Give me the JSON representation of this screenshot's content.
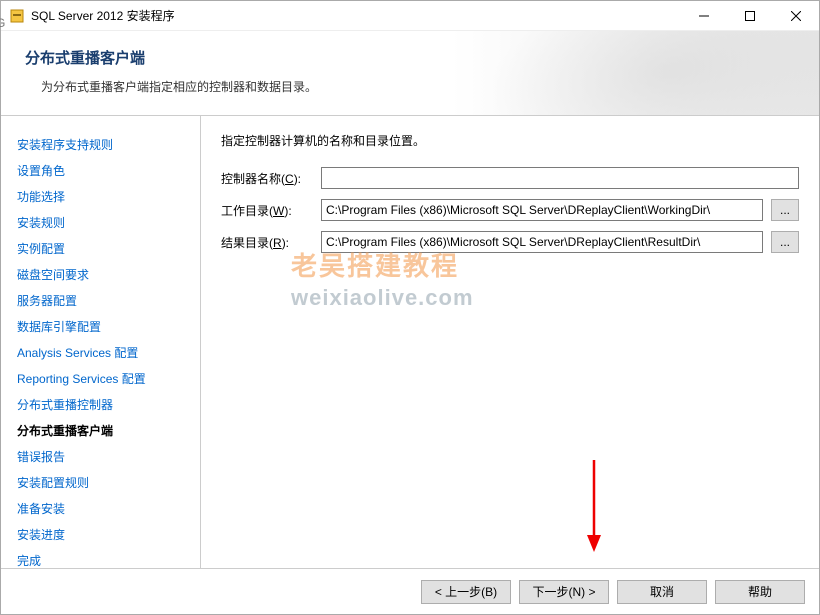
{
  "window": {
    "title": "SQL Server 2012 安装程序"
  },
  "header": {
    "title": "分布式重播客户端",
    "subtitle": "为分布式重播客户端指定相应的控制器和数据目录。"
  },
  "sidebar": {
    "items": [
      {
        "label": "安装程序支持规则",
        "current": false
      },
      {
        "label": "设置角色",
        "current": false
      },
      {
        "label": "功能选择",
        "current": false
      },
      {
        "label": "安装规则",
        "current": false
      },
      {
        "label": "实例配置",
        "current": false
      },
      {
        "label": "磁盘空间要求",
        "current": false
      },
      {
        "label": "服务器配置",
        "current": false
      },
      {
        "label": "数据库引擎配置",
        "current": false
      },
      {
        "label": "Analysis Services 配置",
        "current": false
      },
      {
        "label": "Reporting Services 配置",
        "current": false
      },
      {
        "label": "分布式重播控制器",
        "current": false
      },
      {
        "label": "分布式重播客户端",
        "current": true
      },
      {
        "label": "错误报告",
        "current": false
      },
      {
        "label": "安装配置规则",
        "current": false
      },
      {
        "label": "准备安装",
        "current": false
      },
      {
        "label": "安装进度",
        "current": false
      },
      {
        "label": "完成",
        "current": false
      }
    ]
  },
  "main": {
    "description": "指定控制器计算机的名称和目录位置。",
    "fields": {
      "controller": {
        "label": "控制器名称",
        "accel": "C",
        "value": ""
      },
      "workdir": {
        "label": "工作目录",
        "accel": "W",
        "value": "C:\\Program Files (x86)\\Microsoft SQL Server\\DReplayClient\\WorkingDir\\"
      },
      "resultdir": {
        "label": "结果目录",
        "accel": "R",
        "value": "C:\\Program Files (x86)\\Microsoft SQL Server\\DReplayClient\\ResultDir\\"
      }
    },
    "browse_label": "..."
  },
  "watermark": {
    "line1": "老吴搭建教程",
    "line2": "weixiaolive.com"
  },
  "footer": {
    "back": "< 上一步(B)",
    "next": "下一步(N) >",
    "cancel": "取消",
    "help": "帮助"
  },
  "left_edge": "G"
}
